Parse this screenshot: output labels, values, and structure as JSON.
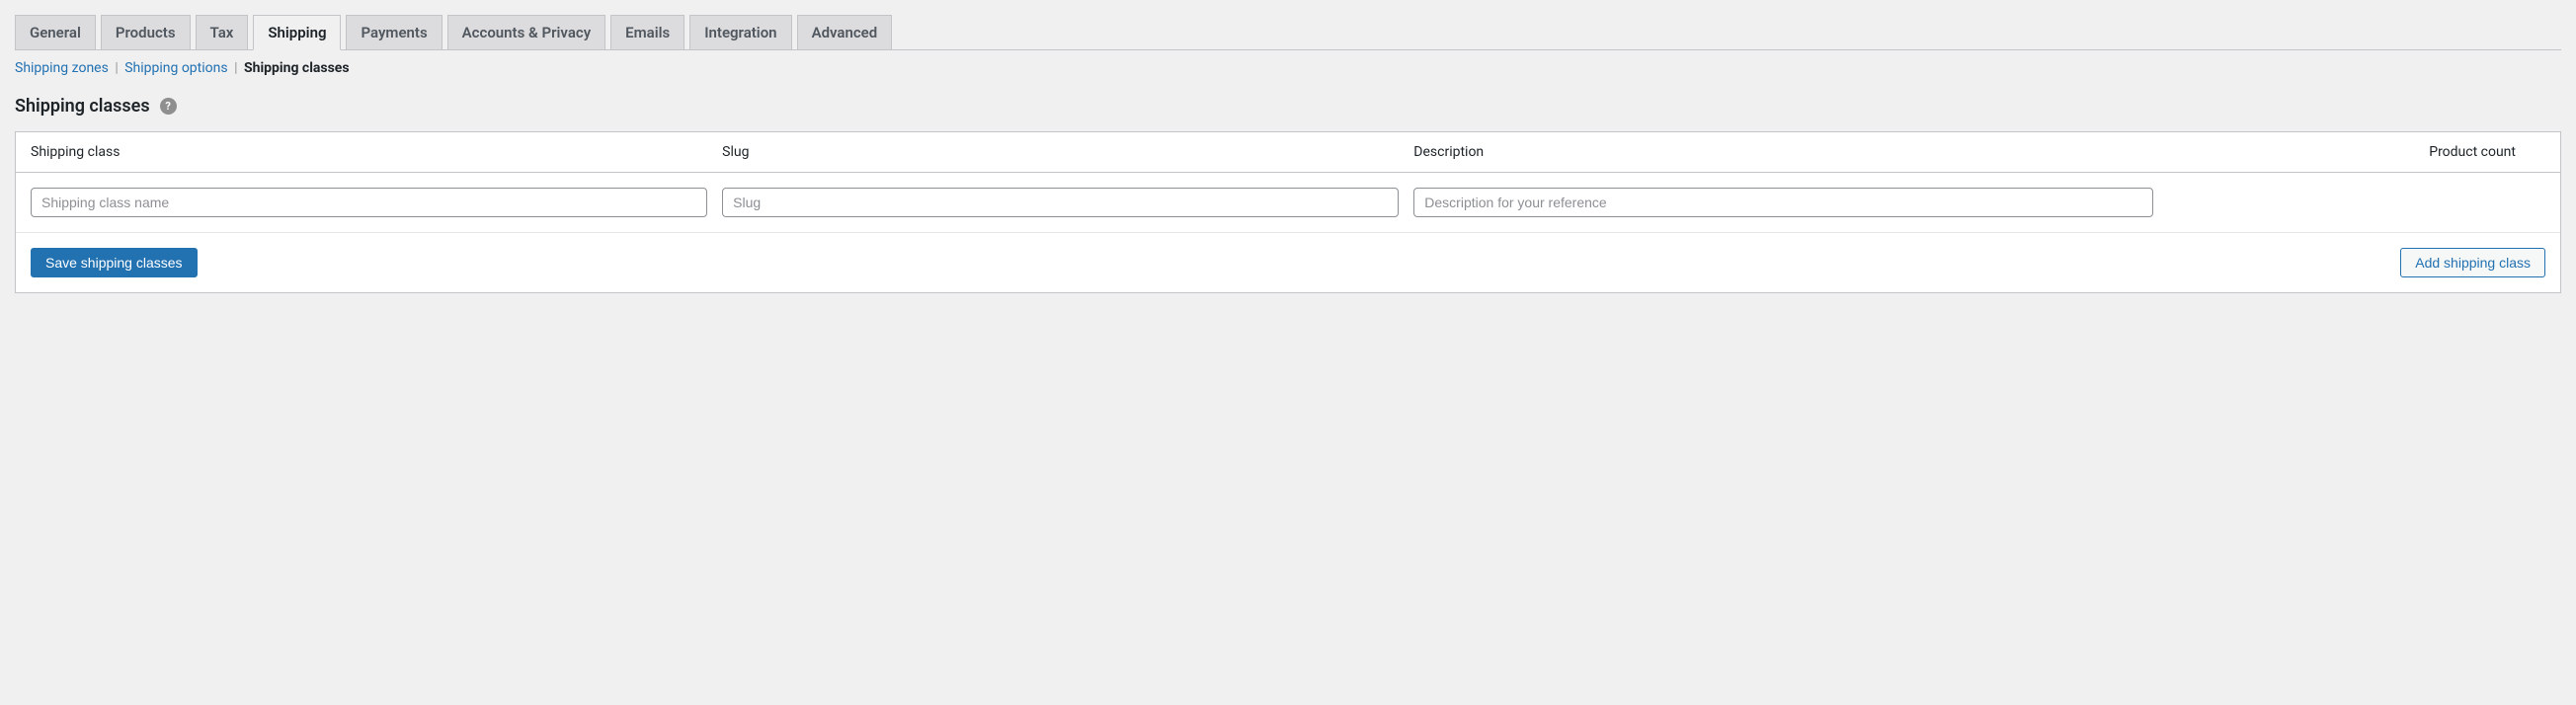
{
  "tabs": [
    {
      "label": "General",
      "active": false
    },
    {
      "label": "Products",
      "active": false
    },
    {
      "label": "Tax",
      "active": false
    },
    {
      "label": "Shipping",
      "active": true
    },
    {
      "label": "Payments",
      "active": false
    },
    {
      "label": "Accounts & Privacy",
      "active": false
    },
    {
      "label": "Emails",
      "active": false
    },
    {
      "label": "Integration",
      "active": false
    },
    {
      "label": "Advanced",
      "active": false
    }
  ],
  "subnav": {
    "zones": "Shipping zones",
    "options": "Shipping options",
    "classes": "Shipping classes"
  },
  "heading": "Shipping classes",
  "help_tooltip": "?",
  "columns": {
    "class": "Shipping class",
    "slug": "Slug",
    "desc": "Description",
    "count": "Product count"
  },
  "row": {
    "class_placeholder": "Shipping class name",
    "class_value": "",
    "slug_placeholder": "Slug",
    "slug_value": "",
    "desc_placeholder": "Description for your reference",
    "desc_value": "",
    "count_value": ""
  },
  "buttons": {
    "save": "Save shipping classes",
    "add": "Add shipping class"
  }
}
